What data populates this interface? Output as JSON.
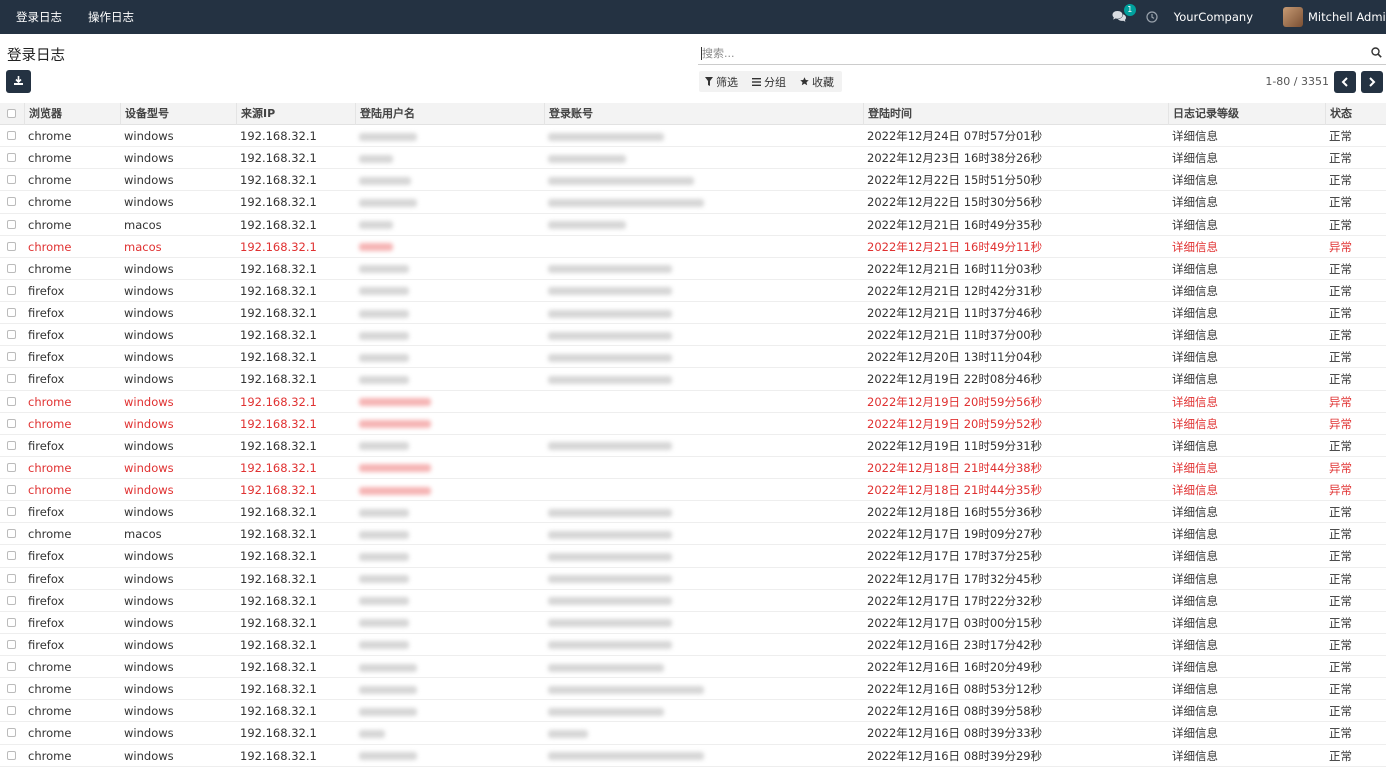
{
  "nav": {
    "menu": [
      "登录日志",
      "操作日志"
    ],
    "message_count": "1",
    "company": "YourCompany",
    "user": "Mitchell Admin"
  },
  "page": {
    "title": "登录日志",
    "search_placeholder": "搜索...",
    "filter_label": "筛选",
    "group_label": "分组",
    "favorite_label": "收藏",
    "pager": "1-80 / 3351"
  },
  "colors": {
    "navbar": "#243242",
    "error": "#e03131",
    "badge": "#00a09d"
  },
  "table": {
    "columns": [
      "浏览器",
      "设备型号",
      "来源IP",
      "登陆用户名",
      "登录账号",
      "登陆时间",
      "日志记录等级",
      "状态"
    ],
    "rows": [
      {
        "browser": "chrome",
        "device": "windows",
        "ip": "192.168.32.1",
        "time": "2022年12月24日 07时57分01秒",
        "level": "详细信息",
        "status": "正常",
        "error": false,
        "u": 58,
        "a": 116
      },
      {
        "browser": "chrome",
        "device": "windows",
        "ip": "192.168.32.1",
        "time": "2022年12月23日 16时38分26秒",
        "level": "详细信息",
        "status": "正常",
        "error": false,
        "u": 34,
        "a": 78
      },
      {
        "browser": "chrome",
        "device": "windows",
        "ip": "192.168.32.1",
        "time": "2022年12月22日 15时51分50秒",
        "level": "详细信息",
        "status": "正常",
        "error": false,
        "u": 52,
        "a": 146
      },
      {
        "browser": "chrome",
        "device": "windows",
        "ip": "192.168.32.1",
        "time": "2022年12月22日 15时30分56秒",
        "level": "详细信息",
        "status": "正常",
        "error": false,
        "u": 58,
        "a": 156
      },
      {
        "browser": "chrome",
        "device": "macos",
        "ip": "192.168.32.1",
        "time": "2022年12月21日 16时49分35秒",
        "level": "详细信息",
        "status": "正常",
        "error": false,
        "u": 34,
        "a": 78
      },
      {
        "browser": "chrome",
        "device": "macos",
        "ip": "192.168.32.1",
        "time": "2022年12月21日 16时49分11秒",
        "level": "详细信息",
        "status": "异常",
        "error": true,
        "u": 34,
        "a": 0
      },
      {
        "browser": "chrome",
        "device": "windows",
        "ip": "192.168.32.1",
        "time": "2022年12月21日 16时11分03秒",
        "level": "详细信息",
        "status": "正常",
        "error": false,
        "u": 50,
        "a": 124
      },
      {
        "browser": "firefox",
        "device": "windows",
        "ip": "192.168.32.1",
        "time": "2022年12月21日 12时42分31秒",
        "level": "详细信息",
        "status": "正常",
        "error": false,
        "u": 50,
        "a": 124
      },
      {
        "browser": "firefox",
        "device": "windows",
        "ip": "192.168.32.1",
        "time": "2022年12月21日 11时37分46秒",
        "level": "详细信息",
        "status": "正常",
        "error": false,
        "u": 50,
        "a": 124
      },
      {
        "browser": "firefox",
        "device": "windows",
        "ip": "192.168.32.1",
        "time": "2022年12月21日 11时37分00秒",
        "level": "详细信息",
        "status": "正常",
        "error": false,
        "u": 50,
        "a": 124
      },
      {
        "browser": "firefox",
        "device": "windows",
        "ip": "192.168.32.1",
        "time": "2022年12月20日 13时11分04秒",
        "level": "详细信息",
        "status": "正常",
        "error": false,
        "u": 50,
        "a": 124
      },
      {
        "browser": "firefox",
        "device": "windows",
        "ip": "192.168.32.1",
        "time": "2022年12月19日 22时08分46秒",
        "level": "详细信息",
        "status": "正常",
        "error": false,
        "u": 50,
        "a": 124
      },
      {
        "browser": "chrome",
        "device": "windows",
        "ip": "192.168.32.1",
        "time": "2022年12月19日 20时59分56秒",
        "level": "详细信息",
        "status": "异常",
        "error": true,
        "u": 72,
        "a": 0
      },
      {
        "browser": "chrome",
        "device": "windows",
        "ip": "192.168.32.1",
        "time": "2022年12月19日 20时59分52秒",
        "level": "详细信息",
        "status": "异常",
        "error": true,
        "u": 72,
        "a": 0
      },
      {
        "browser": "firefox",
        "device": "windows",
        "ip": "192.168.32.1",
        "time": "2022年12月19日 11时59分31秒",
        "level": "详细信息",
        "status": "正常",
        "error": false,
        "u": 50,
        "a": 124
      },
      {
        "browser": "chrome",
        "device": "windows",
        "ip": "192.168.32.1",
        "time": "2022年12月18日 21时44分38秒",
        "level": "详细信息",
        "status": "异常",
        "error": true,
        "u": 72,
        "a": 0
      },
      {
        "browser": "chrome",
        "device": "windows",
        "ip": "192.168.32.1",
        "time": "2022年12月18日 21时44分35秒",
        "level": "详细信息",
        "status": "异常",
        "error": true,
        "u": 72,
        "a": 0
      },
      {
        "browser": "firefox",
        "device": "windows",
        "ip": "192.168.32.1",
        "time": "2022年12月18日 16时55分36秒",
        "level": "详细信息",
        "status": "正常",
        "error": false,
        "u": 50,
        "a": 124
      },
      {
        "browser": "chrome",
        "device": "macos",
        "ip": "192.168.32.1",
        "time": "2022年12月17日 19时09分27秒",
        "level": "详细信息",
        "status": "正常",
        "error": false,
        "u": 50,
        "a": 124
      },
      {
        "browser": "firefox",
        "device": "windows",
        "ip": "192.168.32.1",
        "time": "2022年12月17日 17时37分25秒",
        "level": "详细信息",
        "status": "正常",
        "error": false,
        "u": 50,
        "a": 124
      },
      {
        "browser": "firefox",
        "device": "windows",
        "ip": "192.168.32.1",
        "time": "2022年12月17日 17时32分45秒",
        "level": "详细信息",
        "status": "正常",
        "error": false,
        "u": 50,
        "a": 124
      },
      {
        "browser": "firefox",
        "device": "windows",
        "ip": "192.168.32.1",
        "time": "2022年12月17日 17时22分32秒",
        "level": "详细信息",
        "status": "正常",
        "error": false,
        "u": 50,
        "a": 124
      },
      {
        "browser": "firefox",
        "device": "windows",
        "ip": "192.168.32.1",
        "time": "2022年12月17日 03时00分15秒",
        "level": "详细信息",
        "status": "正常",
        "error": false,
        "u": 50,
        "a": 124
      },
      {
        "browser": "firefox",
        "device": "windows",
        "ip": "192.168.32.1",
        "time": "2022年12月16日 23时17分42秒",
        "level": "详细信息",
        "status": "正常",
        "error": false,
        "u": 50,
        "a": 124
      },
      {
        "browser": "chrome",
        "device": "windows",
        "ip": "192.168.32.1",
        "time": "2022年12月16日 16时20分49秒",
        "level": "详细信息",
        "status": "正常",
        "error": false,
        "u": 58,
        "a": 116
      },
      {
        "browser": "chrome",
        "device": "windows",
        "ip": "192.168.32.1",
        "time": "2022年12月16日 08时53分12秒",
        "level": "详细信息",
        "status": "正常",
        "error": false,
        "u": 58,
        "a": 156
      },
      {
        "browser": "chrome",
        "device": "windows",
        "ip": "192.168.32.1",
        "time": "2022年12月16日 08时39分58秒",
        "level": "详细信息",
        "status": "正常",
        "error": false,
        "u": 58,
        "a": 116
      },
      {
        "browser": "chrome",
        "device": "windows",
        "ip": "192.168.32.1",
        "time": "2022年12月16日 08时39分33秒",
        "level": "详细信息",
        "status": "正常",
        "error": false,
        "u": 26,
        "a": 40
      },
      {
        "browser": "chrome",
        "device": "windows",
        "ip": "192.168.32.1",
        "time": "2022年12月16日 08时39分29秒",
        "level": "详细信息",
        "status": "正常",
        "error": false,
        "u": 58,
        "a": 156
      }
    ]
  }
}
